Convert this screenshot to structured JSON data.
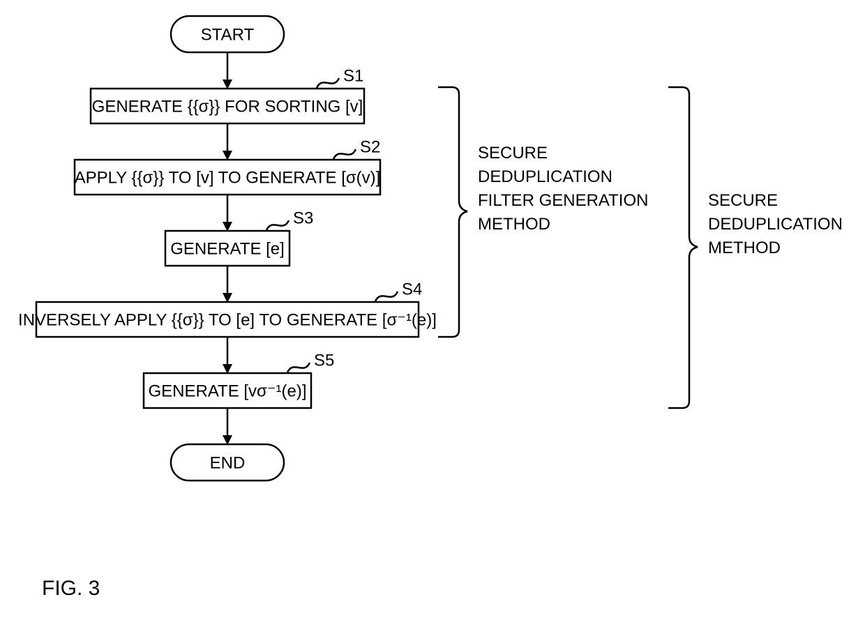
{
  "chart_data": {
    "type": "flowchart",
    "title": "FIG. 3",
    "nodes": [
      {
        "id": "start",
        "shape": "terminator",
        "text": "START"
      },
      {
        "id": "s1",
        "shape": "process",
        "text": "GENERATE {{σ}} FOR SORTING [v]",
        "label": "S1"
      },
      {
        "id": "s2",
        "shape": "process",
        "text": "APPLY {{σ}} TO [v] TO GENERATE [σ(v)]",
        "label": "S2"
      },
      {
        "id": "s3",
        "shape": "process",
        "text": "GENERATE [e]",
        "label": "S3"
      },
      {
        "id": "s4",
        "shape": "process",
        "text": "INVERSELY APPLY {{σ}} TO [e] TO GENERATE [σ⁻¹(e)]",
        "label": "S4"
      },
      {
        "id": "s5",
        "shape": "process",
        "text": "GENERATE [vσ⁻¹(e)]",
        "label": "S5"
      },
      {
        "id": "end",
        "shape": "terminator",
        "text": "END"
      }
    ],
    "edges": [
      {
        "from": "start",
        "to": "s1"
      },
      {
        "from": "s1",
        "to": "s2"
      },
      {
        "from": "s2",
        "to": "s3"
      },
      {
        "from": "s3",
        "to": "s4"
      },
      {
        "from": "s4",
        "to": "s5"
      },
      {
        "from": "s5",
        "to": "end"
      }
    ],
    "annotations": [
      {
        "id": "a1",
        "text": "SECURE DEDUPLICATION FILTER GENERATION METHOD",
        "spans": [
          "s1",
          "s4"
        ]
      },
      {
        "id": "a2",
        "text": "SECURE DEDUPLICATION METHOD",
        "spans": [
          "s1",
          "s5"
        ]
      }
    ]
  },
  "fig_label": "FIG. 3"
}
